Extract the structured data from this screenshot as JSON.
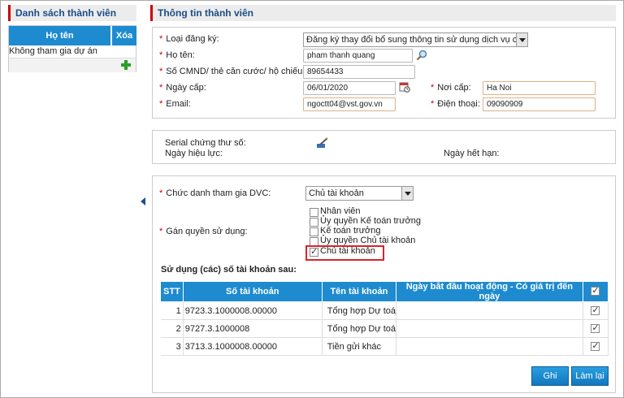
{
  "left": {
    "title": "Danh sách thành viên",
    "col_name": "Họ tên",
    "col_delete": "Xóa",
    "row_text": "Không tham gia dự án"
  },
  "right": {
    "title": "Thông tin thành viên",
    "form": {
      "reg_type_label": "Loại đăng ký:",
      "reg_type_value": "Đăng ký thay đổi bổ sung thông tin sử dụng dịch vụ công",
      "name_label": "Họ tên:",
      "name_value": "pham thanh quang",
      "id_label": "Số CMND/ thẻ căn cước/ hộ chiếu:",
      "id_value": "89654433",
      "date_label": "Ngày cấp:",
      "date_value": "06/01/2020",
      "place_label": "Nơi cấp:",
      "place_value": "Ha Noi",
      "email_label": "Email:",
      "email_value": "ngoctt04@vst.gov.vn",
      "phone_label": "Điện thoại:",
      "phone_value": "09090909"
    },
    "cert": {
      "serial_label": "Serial chứng thư số:",
      "valid_from_label": "Ngày hiệu lực:",
      "valid_to_label": "Ngày hết hạn:"
    },
    "role": {
      "position_label": "Chức danh tham gia DVC:",
      "position_value": "Chủ tài khoản",
      "rights_label": "Gán quyền sử dụng:",
      "rights": [
        {
          "label": "Nhân viên",
          "checked": false
        },
        {
          "label": "Ủy quyền Kế toán trưởng",
          "checked": false
        },
        {
          "label": "Kế toán trưởng",
          "checked": false
        },
        {
          "label": "Ủy quyền Chủ tài khoản",
          "checked": false
        },
        {
          "label": "Chủ tài khoản",
          "checked": true
        }
      ],
      "accounts_title": "Sử dụng (các) số tài khoản sau:"
    },
    "table": {
      "headers": [
        "STT",
        "Số tài khoản",
        "Tên tài khoản",
        "Ngày bắt đầu hoạt động - Có giá trị đến ngày"
      ],
      "rows": [
        {
          "stt": "1",
          "number": "9723.3.1000008.00000",
          "name": "Tổng hợp Dự toá",
          "checked": true
        },
        {
          "stt": "2",
          "number": "9727.3.1000008",
          "name": "Tổng hợp Dự toá",
          "checked": true
        },
        {
          "stt": "3",
          "number": "3713.3.1000008.00000",
          "name": "Tiền gửi khác",
          "checked": true
        }
      ]
    },
    "buttons": {
      "save": "Ghi",
      "reset": "Làm lại"
    }
  },
  "colors": {
    "accent": "#1e8bd0",
    "required": "#cc0000",
    "highlight_box": "#d9232d"
  }
}
